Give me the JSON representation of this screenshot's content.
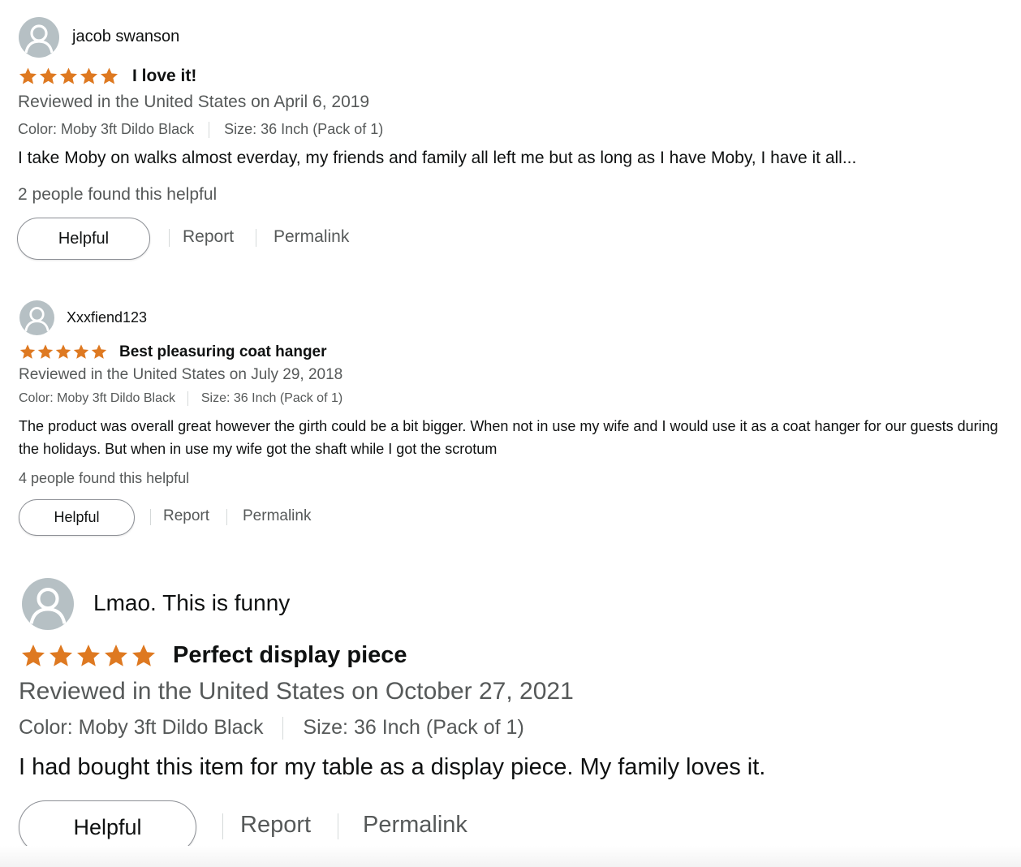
{
  "colors": {
    "star": "#de7921",
    "meta_text": "#565959",
    "main_text": "#0f1111",
    "avatar_bg": "#b6c0c4"
  },
  "icons": {
    "avatar": "user-avatar-icon",
    "star": "star-icon"
  },
  "reviews": [
    {
      "reviewer": "jacob swanson",
      "rating": 5,
      "title": "I love it!",
      "meta": "Reviewed in the United States on April 6, 2019",
      "color": "Color: Moby 3ft Dildo Black",
      "size": "Size: 36 Inch (Pack of 1)",
      "body": "I take Moby on walks almost everday, my friends and family all left me but as long as I have Moby, I have it all...",
      "helpful_count": "2 people found this helpful",
      "helpful_label": "Helpful",
      "report_label": "Report",
      "permalink_label": "Permalink"
    },
    {
      "reviewer": "Xxxfiend123",
      "rating": 5,
      "title": "Best pleasuring coat hanger",
      "meta": "Reviewed in the United States on July 29, 2018",
      "color": "Color: Moby 3ft Dildo Black",
      "size": "Size: 36 Inch (Pack of 1)",
      "body": "The product was overall great however the girth could be a bit bigger. When not in use my wife and I would use it as a coat hanger for our guests during the holidays. But when in use my wife got the shaft while I got the scrotum",
      "helpful_count": "4 people found this helpful",
      "helpful_label": "Helpful",
      "report_label": "Report",
      "permalink_label": "Permalink"
    },
    {
      "reviewer": "Lmao. This is funny",
      "rating": 5,
      "title": "Perfect display piece",
      "meta": "Reviewed in the United States on October 27, 2021",
      "color": "Color: Moby 3ft Dildo Black",
      "size": "Size: 36 Inch (Pack of 1)",
      "body": "I had bought this item for my table as a display piece. My family loves it.",
      "helpful_label": "Helpful",
      "report_label": "Report",
      "permalink_label": "Permalink"
    }
  ]
}
